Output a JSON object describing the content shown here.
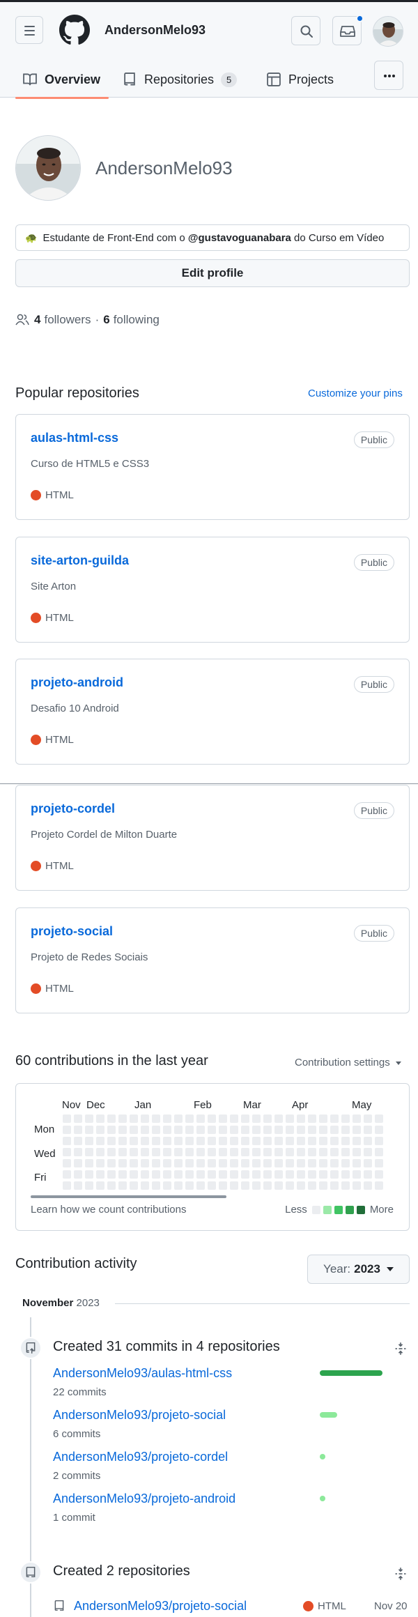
{
  "app": {
    "username": "AndersonMelo93"
  },
  "tabs": [
    {
      "label": "Overview",
      "icon": "book-icon"
    },
    {
      "label": "Repositories",
      "count": "5",
      "icon": "repo-icon"
    },
    {
      "label": "Projects",
      "icon": "table-icon"
    }
  ],
  "profile": {
    "name": "AndersonMelo93",
    "bio_emoji": "🐢",
    "bio_prefix": "Estudante de Front-End com o ",
    "bio_mention": "@gustavoguanabara",
    "bio_suffix": " do Curso em Vídeo",
    "edit_label": "Edit profile",
    "followers_count": "4",
    "followers_label": "followers",
    "separator": "·",
    "following_count": "6",
    "following_label": "following"
  },
  "pinned": {
    "title": "Popular repositories",
    "customize_label": "Customize your pins",
    "repos": [
      {
        "name": "aulas-html-css",
        "visibility": "Public",
        "description": "Curso de HTML5 e CSS3",
        "language": "HTML",
        "language_color": "#e34c26"
      },
      {
        "name": "site-arton-guilda",
        "visibility": "Public",
        "description": "Site Arton",
        "language": "HTML",
        "language_color": "#e34c26"
      },
      {
        "name": "projeto-android",
        "visibility": "Public",
        "description": "Desafio 10 Android",
        "language": "HTML",
        "language_color": "#e34c26"
      },
      {
        "name": "projeto-cordel",
        "visibility": "Public",
        "description": "Projeto Cordel de Milton Duarte",
        "language": "HTML",
        "language_color": "#e34c26"
      },
      {
        "name": "projeto-social",
        "visibility": "Public",
        "description": "Projeto de Redes Sociais",
        "language": "HTML",
        "language_color": "#e34c26"
      }
    ]
  },
  "contributions": {
    "title": "60 contributions in the last year",
    "settings_label": "Contribution settings",
    "months": [
      "Nov",
      "Dec",
      "Jan",
      "Feb",
      "Mar",
      "Apr",
      "May"
    ],
    "days": [
      "Mon",
      "Wed",
      "Fri"
    ],
    "learn_label": "Learn how we count contributions",
    "legend_less": "Less",
    "legend_more": "More",
    "legend_colors": [
      "#ebedf0",
      "#9be9a8",
      "#40c463",
      "#30a14e",
      "#216e39"
    ]
  },
  "activity": {
    "title": "Contribution activity",
    "year_prefix": "Year:",
    "year_value": "2023",
    "month_label": "November",
    "month_year": "2023",
    "commits_heading": "Created 31 commits in 4 repositories",
    "commits": [
      {
        "repo": "AndersonMelo93/aulas-html-css",
        "count_label": "22 commits",
        "commits": 22,
        "color": "#2da44e"
      },
      {
        "repo": "AndersonMelo93/projeto-social",
        "count_label": "6 commits",
        "commits": 6,
        "color": "#8ce99a"
      },
      {
        "repo": "AndersonMelo93/projeto-cordel",
        "count_label": "2 commits",
        "commits": 2,
        "color": "#8ce99a"
      },
      {
        "repo": "AndersonMelo93/projeto-android",
        "count_label": "1 commit",
        "commits": 1,
        "color": "#8ce99a"
      }
    ],
    "repos_heading": "Created 2 repositories",
    "created": [
      {
        "repo": "AndersonMelo93/projeto-social",
        "language": "HTML",
        "language_color": "#e34c26",
        "date": "Nov 20"
      }
    ]
  }
}
